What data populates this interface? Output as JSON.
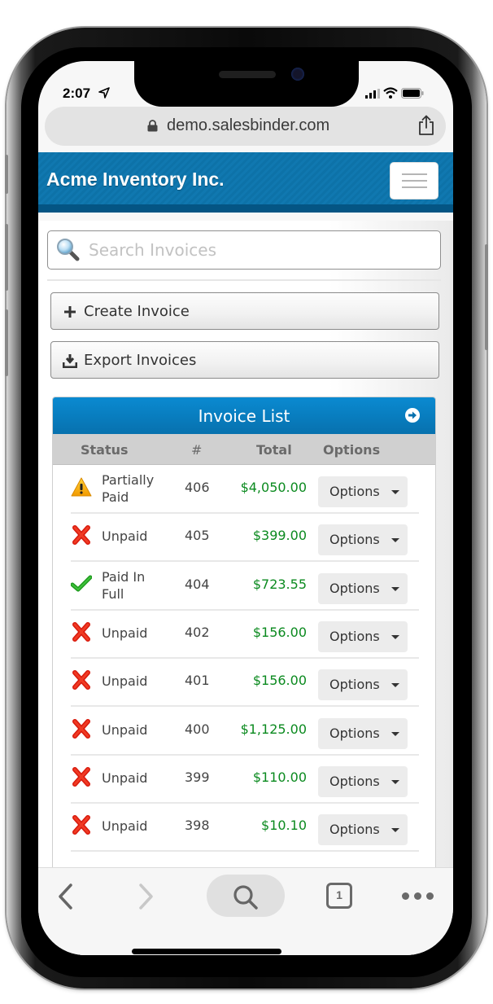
{
  "status_bar": {
    "time": "2:07"
  },
  "browser": {
    "url": "demo.salesbinder.com",
    "tab_count": "1"
  },
  "app": {
    "title": "Acme Inventory Inc."
  },
  "search": {
    "placeholder": "Search Invoices",
    "value": ""
  },
  "actions": {
    "create_label": "Create Invoice",
    "export_label": "Export Invoices"
  },
  "invoice_panel": {
    "title": "Invoice List",
    "columns": {
      "status": "Status",
      "number": "#",
      "total": "Total",
      "options": "Options"
    },
    "rows": [
      {
        "status": "Partially Paid",
        "status_type": "partial",
        "number": "406",
        "total": "$4,050.00",
        "options_label": "Options"
      },
      {
        "status": "Unpaid",
        "status_type": "unpaid",
        "number": "405",
        "total": "$399.00",
        "options_label": "Options"
      },
      {
        "status": "Paid In Full",
        "status_type": "paid",
        "number": "404",
        "total": "$723.55",
        "options_label": "Options"
      },
      {
        "status": "Unpaid",
        "status_type": "unpaid",
        "number": "402",
        "total": "$156.00",
        "options_label": "Options"
      },
      {
        "status": "Unpaid",
        "status_type": "unpaid",
        "number": "401",
        "total": "$156.00",
        "options_label": "Options"
      },
      {
        "status": "Unpaid",
        "status_type": "unpaid",
        "number": "400",
        "total": "$1,125.00",
        "options_label": "Options"
      },
      {
        "status": "Unpaid",
        "status_type": "unpaid",
        "number": "399",
        "total": "$110.00",
        "options_label": "Options"
      },
      {
        "status": "Unpaid",
        "status_type": "unpaid",
        "number": "398",
        "total": "$10.10",
        "options_label": "Options"
      }
    ]
  },
  "colors": {
    "header_blue": "#0d72a8",
    "panel_blue": "#0a8ad1",
    "total_green": "#0b8a1f"
  }
}
